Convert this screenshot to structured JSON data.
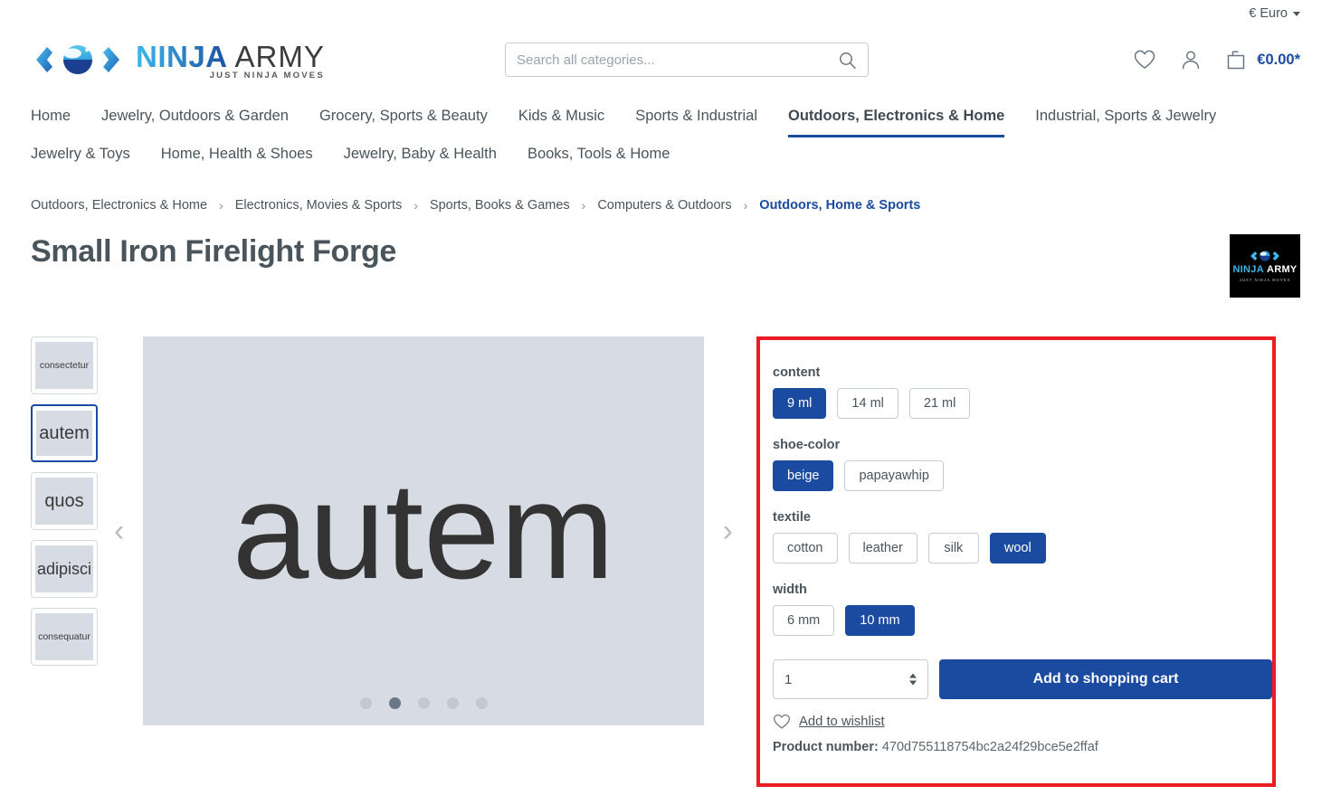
{
  "topbar": {
    "currency_label": "€ Euro"
  },
  "header": {
    "logo": {
      "ninja": "NINJA",
      "army": "ARMY",
      "tagline": "JUST NINJA MOVES"
    },
    "search": {
      "placeholder": "Search all categories...",
      "value": "",
      "icon": "search-icon"
    },
    "actions": {
      "wishlist_icon": "heart-icon",
      "account_icon": "user-icon",
      "cart_icon": "bag-icon",
      "cart_total": "€0.00*"
    }
  },
  "nav": {
    "items": [
      {
        "label": "Home",
        "active": false
      },
      {
        "label": "Jewelry, Outdoors & Garden",
        "active": false
      },
      {
        "label": "Grocery, Sports & Beauty",
        "active": false
      },
      {
        "label": "Kids & Music",
        "active": false
      },
      {
        "label": "Sports & Industrial",
        "active": false
      },
      {
        "label": "Outdoors, Electronics & Home",
        "active": true
      },
      {
        "label": "Industrial, Sports & Jewelry",
        "active": false
      },
      {
        "label": "Jewelry & Toys",
        "active": false
      },
      {
        "label": "Home, Health & Shoes",
        "active": false
      },
      {
        "label": "Jewelry, Baby & Health",
        "active": false
      },
      {
        "label": "Books, Tools & Home",
        "active": false
      }
    ]
  },
  "breadcrumb": {
    "separator": "›",
    "items": [
      {
        "label": "Outdoors, Electronics & Home",
        "current": false
      },
      {
        "label": "Electronics, Movies & Sports",
        "current": false
      },
      {
        "label": "Sports, Books & Games",
        "current": false
      },
      {
        "label": "Computers & Outdoors",
        "current": false
      },
      {
        "label": "Outdoors, Home & Sports",
        "current": true
      }
    ]
  },
  "product": {
    "title": "Small Iron Firelight Forge",
    "brand_logo": {
      "ninja": "NINJA",
      "army": "ARMY",
      "tagline": "JUST NINJA MOVES"
    },
    "gallery": {
      "main_image_text": "autem",
      "prev_arrow": "‹",
      "next_arrow": "›",
      "thumbnails": [
        {
          "label": "consectetur",
          "selected": false,
          "size": "small"
        },
        {
          "label": "autem",
          "selected": true,
          "size": "big"
        },
        {
          "label": "quos",
          "selected": false,
          "size": "big"
        },
        {
          "label": "adipisci",
          "selected": false,
          "size": "mid"
        },
        {
          "label": "consequatur",
          "selected": false,
          "size": "small"
        }
      ],
      "dots": [
        {
          "active": false
        },
        {
          "active": true
        },
        {
          "active": false
        },
        {
          "active": false
        },
        {
          "active": false
        }
      ]
    },
    "options": [
      {
        "label": "content",
        "values": [
          {
            "label": "9 ml",
            "selected": true
          },
          {
            "label": "14 ml",
            "selected": false
          },
          {
            "label": "21 ml",
            "selected": false
          }
        ]
      },
      {
        "label": "shoe-color",
        "values": [
          {
            "label": "beige",
            "selected": true
          },
          {
            "label": "papayawhip",
            "selected": false
          }
        ]
      },
      {
        "label": "textile",
        "values": [
          {
            "label": "cotton",
            "selected": false
          },
          {
            "label": "leather",
            "selected": false
          },
          {
            "label": "silk",
            "selected": false
          },
          {
            "label": "wool",
            "selected": true
          }
        ]
      },
      {
        "label": "width",
        "values": [
          {
            "label": "6 mm",
            "selected": false
          },
          {
            "label": "10 mm",
            "selected": true
          }
        ]
      }
    ],
    "quantity": "1",
    "add_to_cart_label": "Add to shopping cart",
    "wishlist_label": "Add to wishlist",
    "wishlist_icon": "heart-icon",
    "product_number_label": "Product number:",
    "product_number_value": "470d755118754bc2a24f29bce5e2ffaf"
  },
  "colors": {
    "brand_blue": "#1b4ba0",
    "accent_cyan": "#3fb6ea",
    "highlight_red": "#ed1c24",
    "text": "#4a545b",
    "image_bg": "#d7dbe3"
  }
}
